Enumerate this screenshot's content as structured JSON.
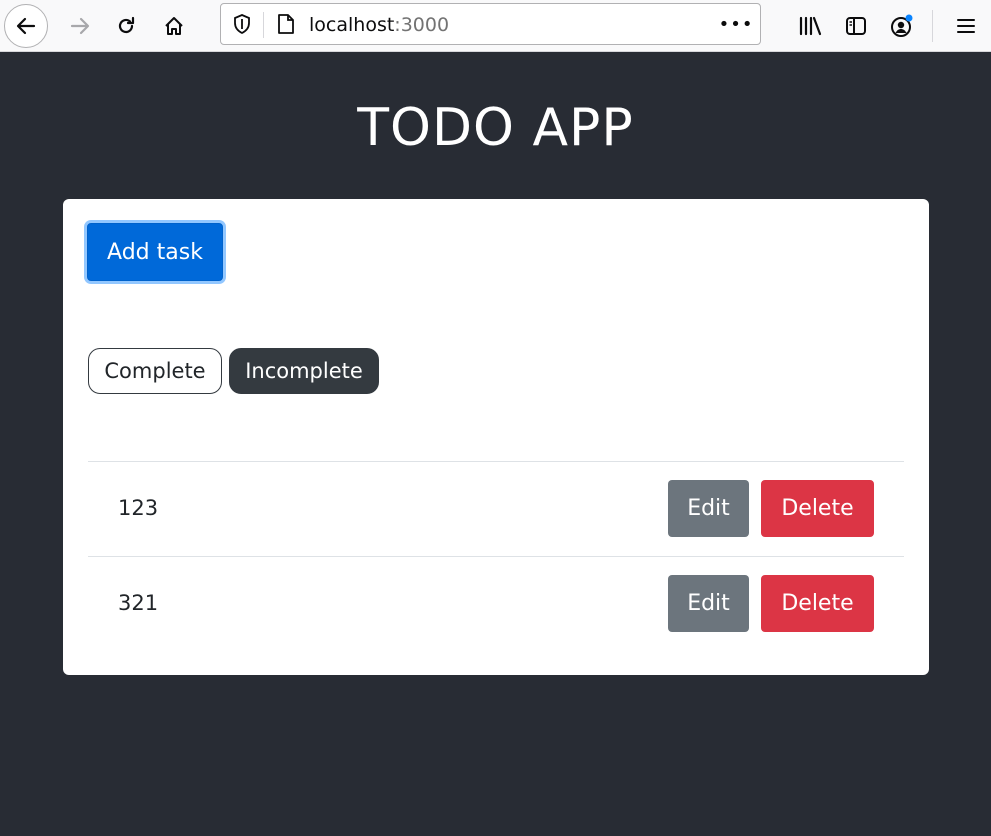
{
  "browser": {
    "url_host": "localhost",
    "url_port": ":3000",
    "more_label": "•••"
  },
  "app": {
    "title": "TODO APP",
    "add_button_label": "Add task",
    "filters": [
      {
        "label": "Complete",
        "active": false
      },
      {
        "label": "Incomplete",
        "active": true
      }
    ],
    "tasks": [
      {
        "text": "123",
        "edit_label": "Edit",
        "delete_label": "Delete"
      },
      {
        "text": "321",
        "edit_label": "Edit",
        "delete_label": "Delete"
      }
    ]
  },
  "colors": {
    "background": "#282c34",
    "primary": "#0069d9",
    "secondary": "#6c757d",
    "danger": "#dc3545",
    "dark": "#343a40"
  }
}
